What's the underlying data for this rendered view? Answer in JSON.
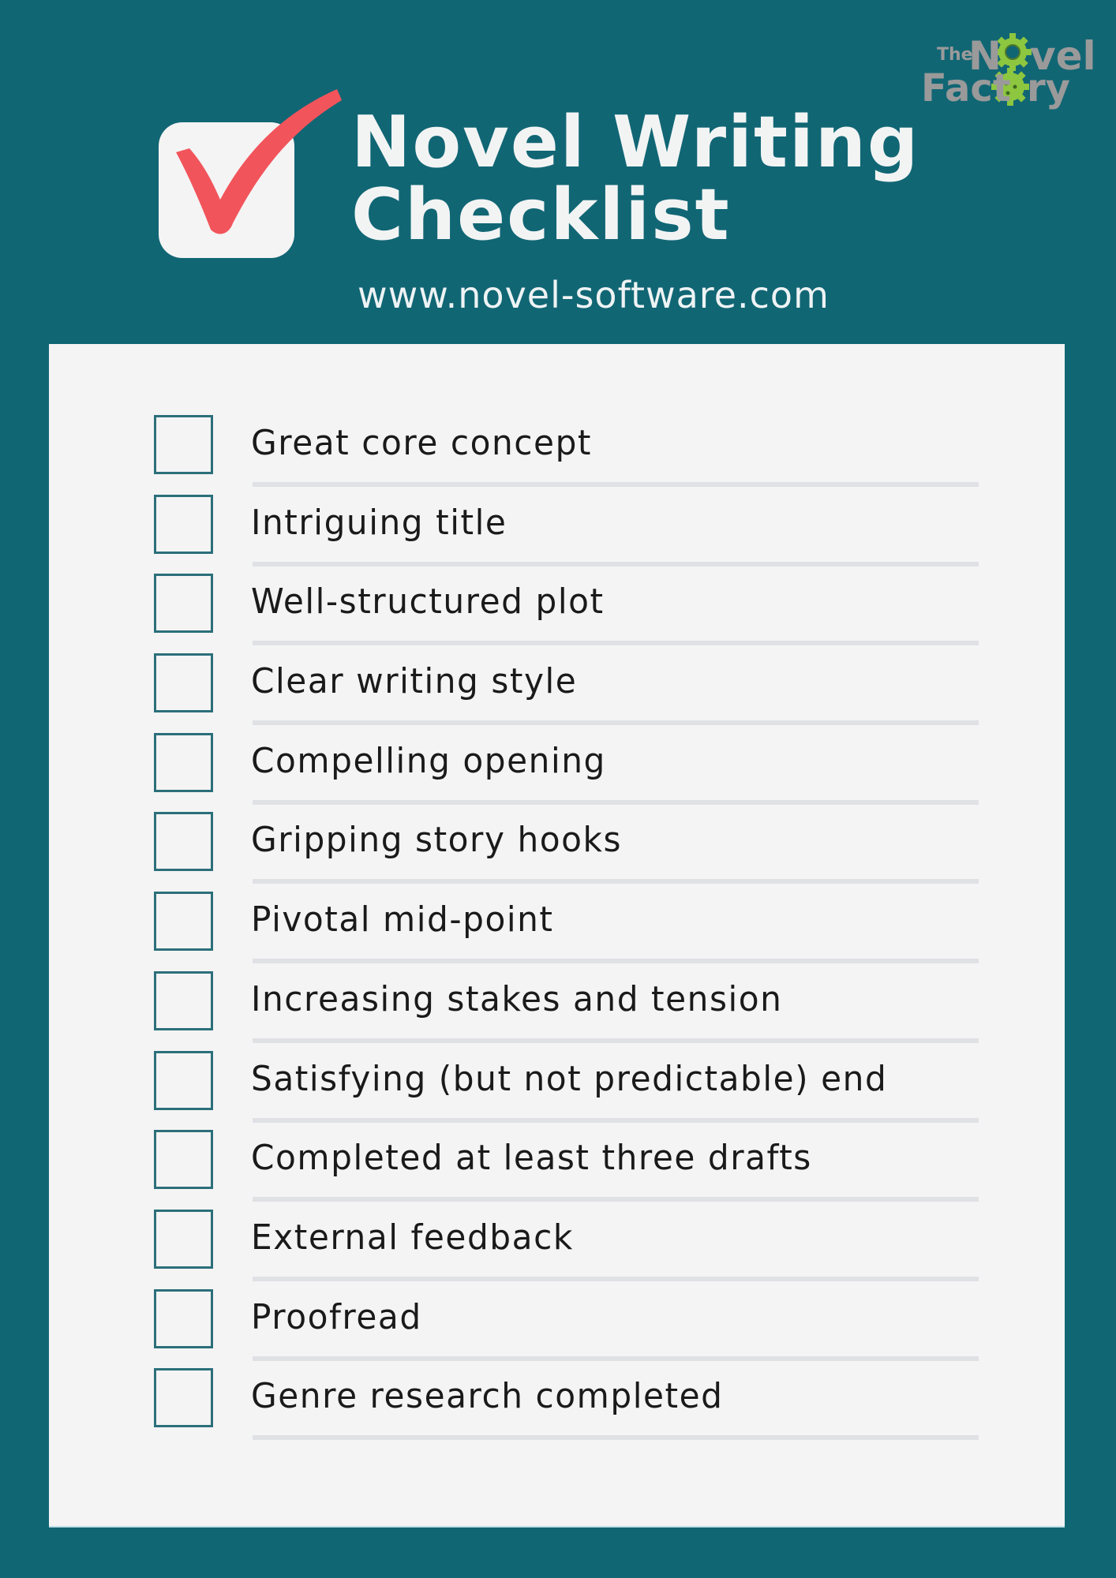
{
  "brand": {
    "logo_line1_prefix": "The",
    "logo_line1_word": "Novel",
    "logo_line2_word": "Factory",
    "colors": {
      "background": "#116674",
      "card": "#f4f4f4",
      "checkmark": "#f2545b",
      "gear": "#8dc63f",
      "logo_text": "#9a9a9a"
    }
  },
  "header": {
    "icon": "checkbox-checked-icon",
    "title_line1": "Novel Writing",
    "title_line2": "Checklist",
    "url": "www.novel-software.com"
  },
  "checklist": {
    "items": [
      {
        "label": "Great core concept",
        "checked": false
      },
      {
        "label": "Intriguing title",
        "checked": false
      },
      {
        "label": "Well-structured plot",
        "checked": false
      },
      {
        "label": "Clear writing style",
        "checked": false
      },
      {
        "label": "Compelling opening",
        "checked": false
      },
      {
        "label": "Gripping story hooks",
        "checked": false
      },
      {
        "label": "Pivotal mid-point",
        "checked": false
      },
      {
        "label": "Increasing stakes and tension",
        "checked": false
      },
      {
        "label": "Satisfying (but not predictable) end",
        "checked": false
      },
      {
        "label": "Completed at least three drafts",
        "checked": false
      },
      {
        "label": "External feedback",
        "checked": false
      },
      {
        "label": "Proofread",
        "checked": false
      },
      {
        "label": "Genre research completed",
        "checked": false
      }
    ]
  }
}
